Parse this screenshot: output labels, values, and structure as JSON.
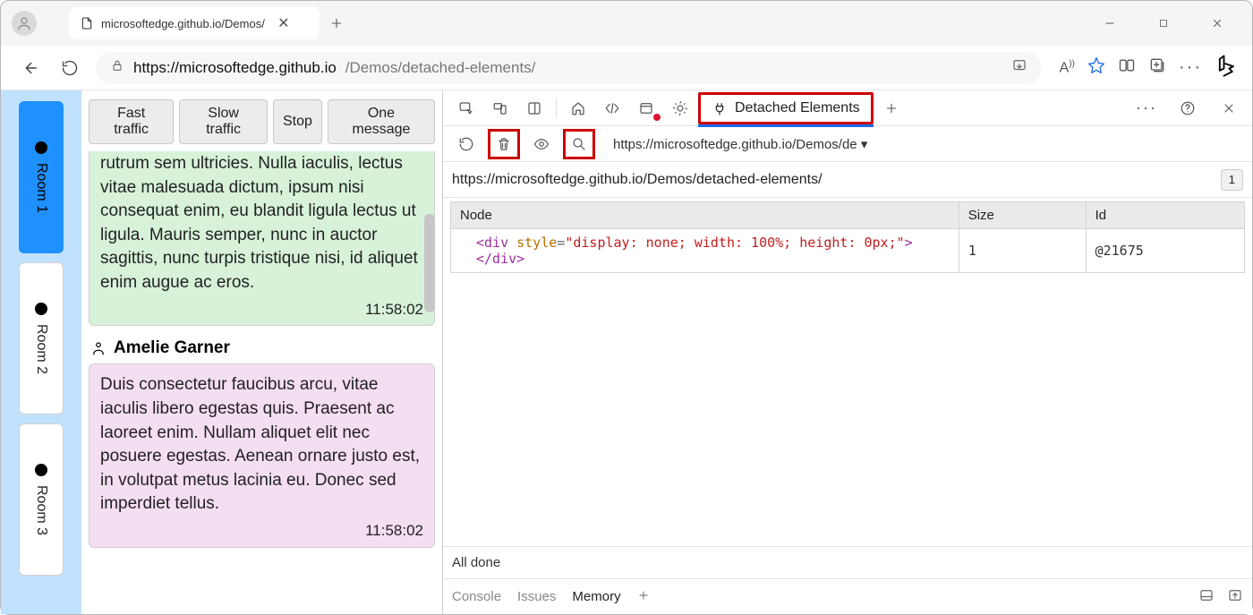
{
  "browser": {
    "tab_title": "microsoftedge.github.io/Demos/",
    "url_host": "https://microsoftedge.github.io",
    "url_rest": "/Demos/detached-elements/"
  },
  "app": {
    "rooms": [
      {
        "label": "Room 1",
        "active": true
      },
      {
        "label": "Room 2",
        "active": false
      },
      {
        "label": "Room 3",
        "active": false
      }
    ],
    "controls": {
      "fast": "Fast traffic",
      "slow": "Slow traffic",
      "stop": "Stop",
      "one": "One message"
    },
    "messages": {
      "m1_text": "rutrum sem ultricies. Nulla iaculis, lectus vitae malesuada dictum, ipsum nisi consequat enim, eu blandit ligula lectus ut ligula. Mauris semper, nunc in auctor sagittis, nunc turpis tristique nisi, id aliquet enim augue ac eros.",
      "m1_time": "11:58:02",
      "m2_author": "Amelie Garner",
      "m2_text": "Duis consectetur faucibus arcu, vitae iaculis libero egestas quis. Praesent ac laoreet enim. Nullam aliquet elit nec posuere egestas. Aenean ornare justo est, in volutpat metus lacinia eu. Donec sed imperdiet tellus.",
      "m2_time": "11:58:02"
    }
  },
  "devtools": {
    "tab_detached_label": "Detached Elements",
    "frame_selector": "https://microsoftedge.github.io/Demos/de",
    "path": "https://microsoftedge.github.io/Demos/detached-elements/",
    "path_count": "1",
    "table": {
      "headers": {
        "node": "Node",
        "size": "Size",
        "id": "Id"
      },
      "row": {
        "node_html_open": "<div",
        "node_attr": "style",
        "node_eq": "=",
        "node_val": "\"display: none; width: 100%; height: 0px;\"",
        "node_html_mid": ">",
        "node_html_close": "</div>",
        "size": "1",
        "id": "@21675"
      }
    },
    "status": "All done",
    "drawer": {
      "console": "Console",
      "issues": "Issues",
      "memory": "Memory"
    }
  }
}
